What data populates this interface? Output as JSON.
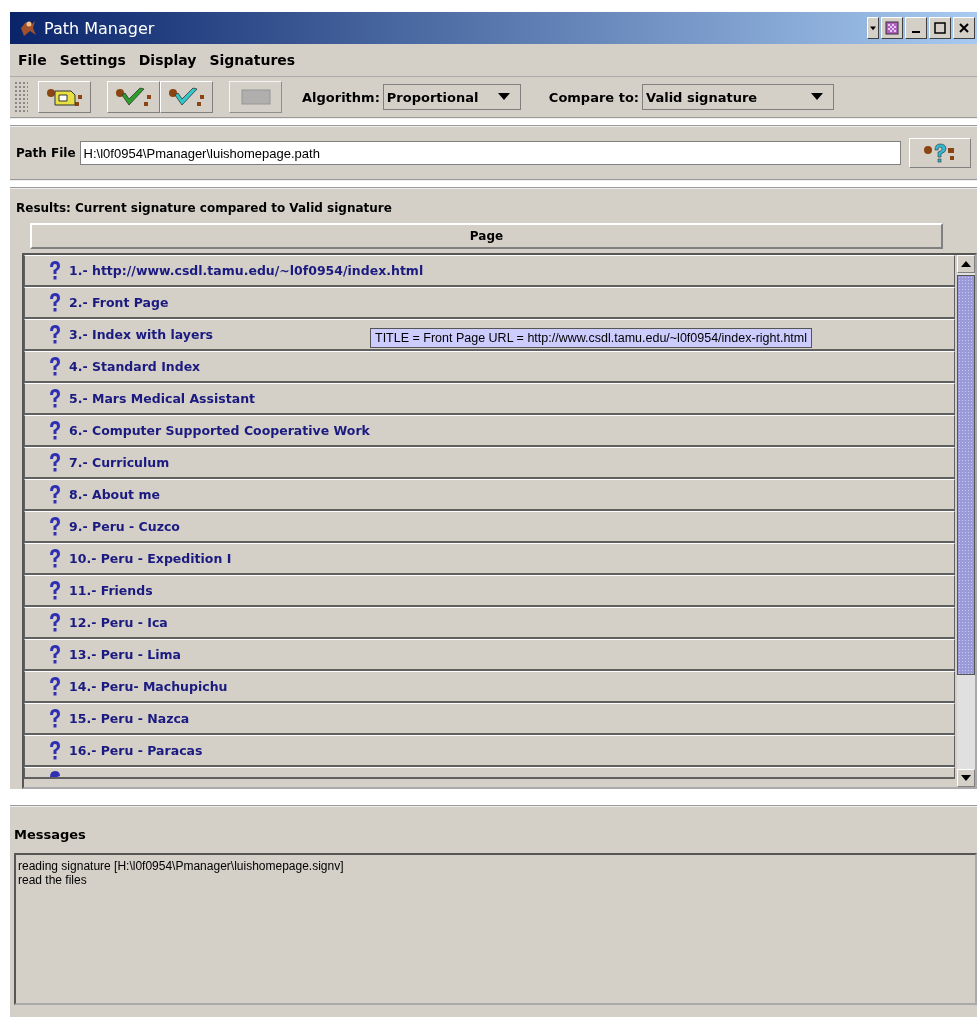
{
  "window": {
    "title": "Path Manager"
  },
  "menu": [
    "File",
    "Settings",
    "Display",
    "Signatures"
  ],
  "toolbar": {
    "algorithm": {
      "label": "Algorithm:",
      "value": "Proportional"
    },
    "compare": {
      "label": "Compare to:",
      "value": "Valid signature"
    },
    "buttons": [
      {
        "kind": "open",
        "disabled": false
      },
      {
        "kind": "check-green",
        "disabled": false
      },
      {
        "kind": "check-cyan",
        "disabled": false
      },
      {
        "kind": "blank",
        "disabled": true
      }
    ]
  },
  "path_file": {
    "label": "Path File",
    "value": "H:\\l0f0954\\Pmanager\\luishomepage.path"
  },
  "results": {
    "title": "Results: Current signature compared to Valid signature",
    "column": "Page",
    "rows": [
      {
        "label": "1.- http://www.csdl.tamu.edu/~l0f0954/index.html"
      },
      {
        "label": "2.- Front Page"
      },
      {
        "label": "3.- Index with layers"
      },
      {
        "label": "4.- Standard Index"
      },
      {
        "label": "5.- Mars Medical Assistant"
      },
      {
        "label": "6.- Computer Supported Cooperative Work"
      },
      {
        "label": "7.- Curriculum"
      },
      {
        "label": "8.- About me"
      },
      {
        "label": "9.- Peru - Cuzco"
      },
      {
        "label": "10.- Peru - Expedition I"
      },
      {
        "label": "11.- Friends"
      },
      {
        "label": "12.- Peru - Ica"
      },
      {
        "label": "13.- Peru - Lima"
      },
      {
        "label": "14.- Peru- Machupichu"
      },
      {
        "label": "15.- Peru - Nazca"
      },
      {
        "label": "16.- Peru - Paracas"
      }
    ],
    "tooltip": "TITLE = Front Page  URL = http://www.csdl.tamu.edu/~l0f0954/index-right.html"
  },
  "messages": {
    "title": "Messages",
    "lines": [
      "reading signature [H:\\l0f0954\\Pmanager\\luishomepage.signv]",
      "read the files"
    ]
  }
}
